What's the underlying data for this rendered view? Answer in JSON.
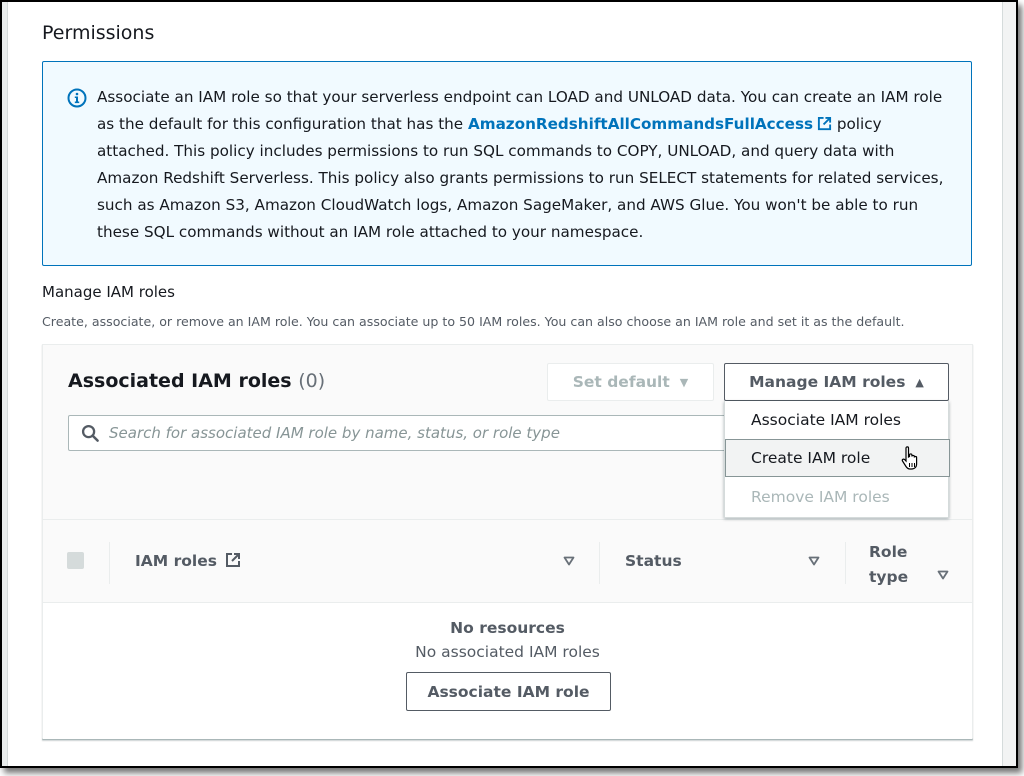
{
  "section": {
    "title": "Permissions"
  },
  "info": {
    "icon": "info-icon",
    "text_before_link": "Associate an IAM role so that your serverless endpoint can LOAD and UNLOAD data. You can create an IAM role as the default for this configuration that has the ",
    "link_text": "AmazonRedshiftAllCommandsFullAccess",
    "link_icon": "external-link-icon",
    "text_after_link": " policy attached. This policy includes permissions to run SQL commands to COPY, UNLOAD, and query data with Amazon Redshift Serverless. This policy also grants permissions to run SELECT statements for related services, such as Amazon S3, Amazon CloudWatch logs, Amazon SageMaker, and AWS Glue. You won't be able to run these SQL commands without an IAM role attached to your namespace."
  },
  "manage": {
    "label": "Manage IAM roles",
    "description": "Create, associate, or remove an IAM role. You can associate up to 50 IAM roles. You can also choose an IAM role and set it as the default."
  },
  "roles_panel": {
    "title": "Associated IAM roles",
    "count": "(0)",
    "set_default_label": "Set default",
    "set_default_caret": "▼",
    "manage_label": "Manage IAM roles",
    "manage_caret": "▲",
    "search_placeholder": "Search for associated IAM role by name, status, or role type",
    "search_value": "",
    "menu": [
      {
        "label": "Associate IAM roles",
        "state": "normal"
      },
      {
        "label": "Create IAM role",
        "state": "hover"
      },
      {
        "label": "Remove IAM roles",
        "state": "disabled"
      }
    ],
    "columns": [
      {
        "label": "IAM roles",
        "icon": "external-link-icon"
      },
      {
        "label": "Status"
      },
      {
        "label": "Role type",
        "line1": "Role",
        "line2": "type"
      }
    ],
    "empty": {
      "title": "No resources",
      "subtitle": "No associated IAM roles",
      "button_label": "Associate IAM role"
    }
  },
  "colors": {
    "link": "#0073bb",
    "info_bg": "#f1faff",
    "info_border": "#0073bb",
    "text": "#16191f",
    "secondary_text": "#545b64",
    "disabled": "#aab7b8"
  }
}
